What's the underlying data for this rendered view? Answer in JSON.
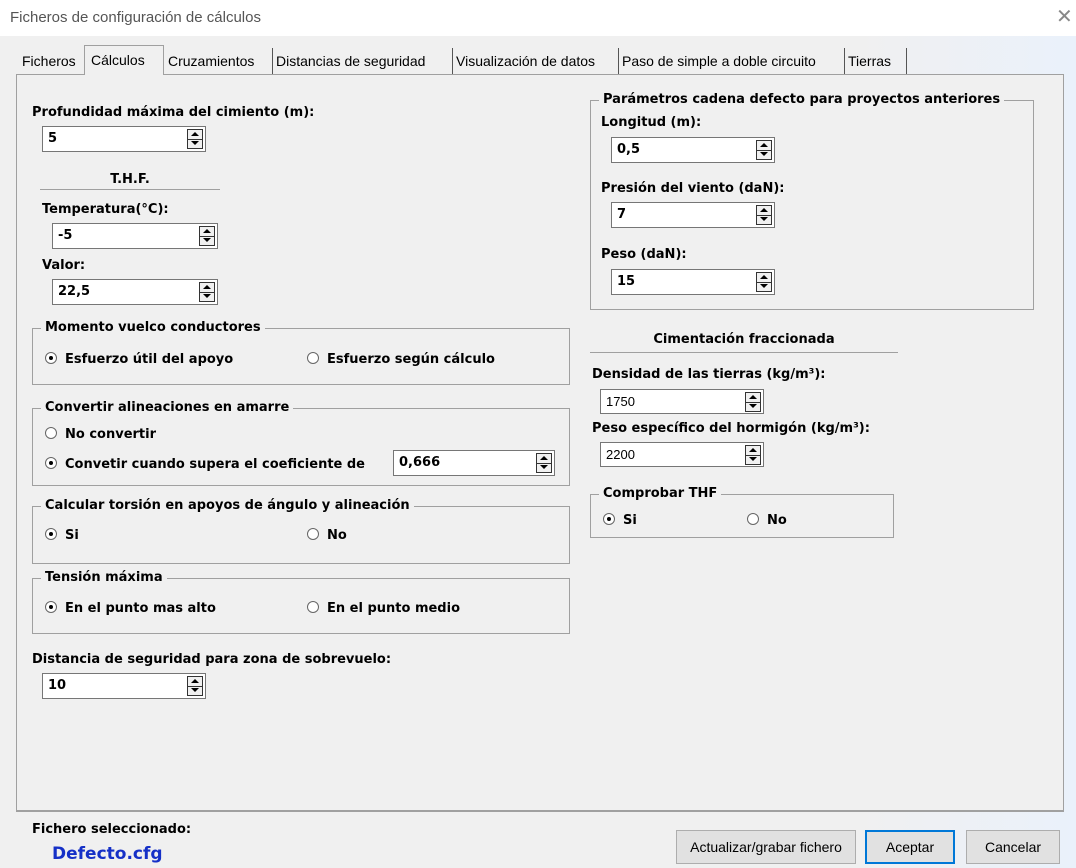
{
  "window": {
    "title": "Ficheros de configuración de cálculos",
    "close_glyph": "✕"
  },
  "tabs": [
    "Ficheros",
    "Cálculos",
    "Cruzamientos",
    "Distancias de seguridad",
    "Visualización de datos",
    "Paso de simple a doble circuito",
    "Tierras"
  ],
  "active_tab": "Cálculos",
  "calculos": {
    "profundidad": {
      "label": "Profundidad máxima del cimiento (m):",
      "value": "5"
    },
    "thf": {
      "header": "T.H.F.",
      "temperatura_label": "Temperatura(°C):",
      "temperatura_value": "-5",
      "valor_label": "Valor:",
      "valor_value": "22,5"
    },
    "momento": {
      "title": "Momento vuelco conductores",
      "opt1": "Esfuerzo útil del apoyo",
      "opt2": "Esfuerzo según cálculo",
      "selected": "opt1"
    },
    "convertir": {
      "title": "Convertir alineaciones en amarre",
      "opt1": "No convertir",
      "opt2": "Convetir cuando supera el coeficiente de",
      "coef": "0,666",
      "selected": "opt2"
    },
    "torsion": {
      "title": "Calcular torsión en apoyos de ángulo y alineación",
      "opt1": "Si",
      "opt2": "No",
      "selected": "opt1"
    },
    "tension": {
      "title": "Tensión máxima",
      "opt1": "En el punto mas alto",
      "opt2": "En el punto medio",
      "selected": "opt1"
    },
    "distancia": {
      "label": "Distancia de seguridad para zona de sobrevuelo:",
      "value": "10"
    },
    "cadena": {
      "title": "Parámetros cadena defecto para proyectos anteriores",
      "longitud_label": "Longitud (m):",
      "longitud_value": "0,5",
      "presion_label": "Presión del viento (daN):",
      "presion_value": "7",
      "peso_label": "Peso (daN):",
      "peso_value": "15"
    },
    "cimentacion": {
      "header": "Cimentación fraccionada",
      "densidad_label": "Densidad de las tierras (kg/m³):",
      "densidad_value": "1750",
      "peso_label": "Peso específico del hormigón (kg/m³):",
      "peso_value": "2200"
    },
    "thf_check": {
      "title": "Comprobar THF",
      "opt1": "Si",
      "opt2": "No",
      "selected": "opt1"
    }
  },
  "footer": {
    "selected_label": "Fichero seleccionado:",
    "selected_file": "Defecto.cfg",
    "btn_update": "Actualizar/grabar fichero",
    "btn_accept": "Aceptar",
    "btn_cancel": "Cancelar"
  }
}
